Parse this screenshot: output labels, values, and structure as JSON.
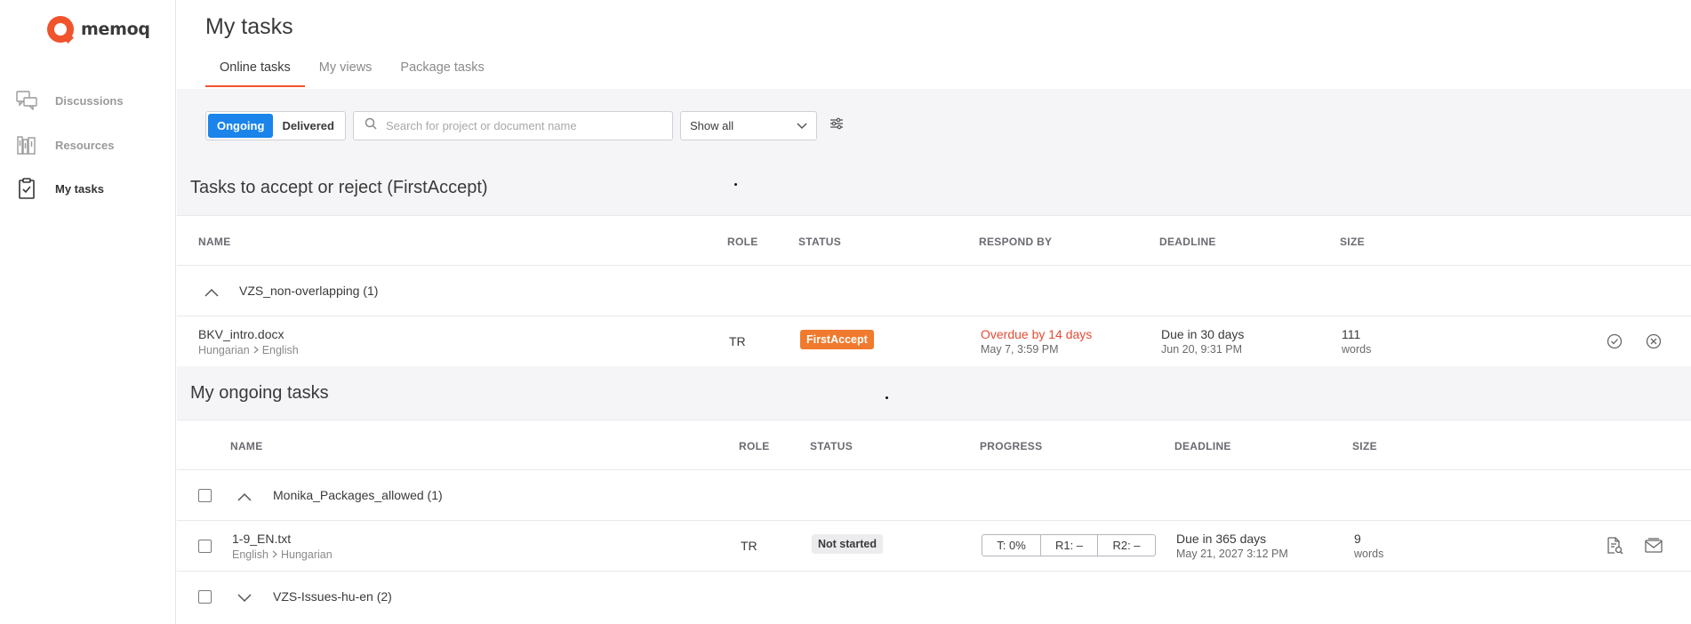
{
  "brand": {
    "name": "memoq",
    "color": "#f0542d"
  },
  "sidebar": {
    "items": [
      {
        "label": "Discussions",
        "icon": "discussions-icon"
      },
      {
        "label": "Resources",
        "icon": "resources-icon"
      },
      {
        "label": "My tasks",
        "icon": "clipboard-icon",
        "active": true
      }
    ]
  },
  "header": {
    "title": "My tasks",
    "tabs": [
      {
        "label": "Online tasks",
        "active": true
      },
      {
        "label": "My views"
      },
      {
        "label": "Package tasks"
      }
    ]
  },
  "toolbar": {
    "toggle": [
      "Ongoing",
      "Delivered"
    ],
    "search_placeholder": "Search for project or document name",
    "filter_select": "Show all"
  },
  "accept_section": {
    "title": "Tasks to accept or reject (FirstAccept)",
    "columns": [
      "NAME",
      "ROLE",
      "STATUS",
      "RESPOND BY",
      "DEADLINE",
      "SIZE"
    ],
    "group": "VZS_non-overlapping (1)",
    "row": {
      "name": "BKV_intro.docx",
      "source_lang": "Hungarian",
      "target_lang": "English",
      "role": "TR",
      "status": "FirstAccept",
      "respond_by": "Overdue by 14 days",
      "respond_by_date": "May 7, 3:59 PM",
      "deadline": "Due in 30 days",
      "deadline_date": "Jun 20, 9:31 PM",
      "size": "111",
      "size_unit": "words"
    }
  },
  "ongoing_section": {
    "title": "My ongoing tasks",
    "columns": [
      "NAME",
      "ROLE",
      "STATUS",
      "PROGRESS",
      "DEADLINE",
      "SIZE"
    ],
    "group1": "Monika_Packages_allowed (1)",
    "row": {
      "name": "1-9_EN.txt",
      "source_lang": "English",
      "target_lang": "Hungarian",
      "role": "TR",
      "status": "Not started",
      "progress": [
        "T: 0%",
        "R1: –",
        "R2: –"
      ],
      "deadline": "Due in 365 days",
      "deadline_date": "May 21, 2027 3:12 PM",
      "size": "9",
      "size_unit": "words"
    },
    "group2": "VZS-Issues-hu-en (2)"
  },
  "colors": {
    "accent": "#1a84ea",
    "orange_badge": "#f07a2d",
    "overdue": "#e54b35"
  }
}
